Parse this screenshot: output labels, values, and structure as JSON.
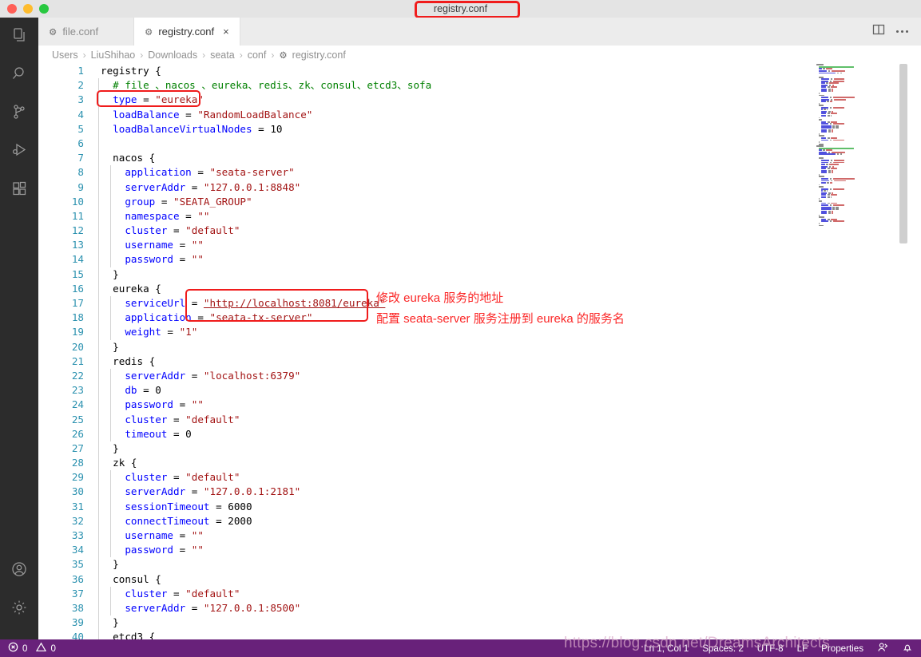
{
  "titlebar": {
    "title": "registry.conf",
    "traffic_lights": [
      "close-red",
      "minimize-yellow",
      "maximize-green"
    ],
    "annotation_color": "#f01c1c"
  },
  "activitybar": {
    "items": [
      {
        "name": "explorer",
        "icon": "files-icon"
      },
      {
        "name": "search",
        "icon": "search-icon"
      },
      {
        "name": "source-control",
        "icon": "source-control-icon"
      },
      {
        "name": "run-and-debug",
        "icon": "run-debug-icon"
      },
      {
        "name": "extensions",
        "icon": "extensions-icon"
      }
    ],
    "bottom_items": [
      {
        "name": "accounts",
        "icon": "account-icon"
      },
      {
        "name": "manage-settings",
        "icon": "gear-icon"
      }
    ]
  },
  "tabs": [
    {
      "label": "file.conf",
      "icon": "gear-icon",
      "active": false,
      "closable": false
    },
    {
      "label": "registry.conf",
      "icon": "gear-icon",
      "active": true,
      "closable": true,
      "close_label": "×"
    }
  ],
  "tab_actions": [
    {
      "name": "split-editor",
      "icon": "split-editor-icon"
    },
    {
      "name": "more-actions",
      "icon": "ellipsis-icon"
    }
  ],
  "breadcrumb": {
    "separator": "›",
    "items": [
      "Users",
      "LiuShihao",
      "Downloads",
      "seata",
      "conf"
    ],
    "file": "registry.conf",
    "file_icon": "gear-icon"
  },
  "editor": {
    "language": "conf",
    "lines": [
      {
        "n": 1,
        "indent": 0,
        "tokens": [
          {
            "t": "registry {",
            "c": "plain"
          }
        ]
      },
      {
        "n": 2,
        "indent": 1,
        "tokens": [
          {
            "t": "# file 、nacos 、eureka、redis、zk、consul、etcd3、sofa",
            "c": "cmt"
          }
        ]
      },
      {
        "n": 3,
        "indent": 1,
        "tokens": [
          {
            "t": "type",
            "c": "kw"
          },
          {
            "t": " = ",
            "c": "plain"
          },
          {
            "t": "\"eureka\"",
            "c": "str"
          }
        ]
      },
      {
        "n": 4,
        "indent": 1,
        "tokens": [
          {
            "t": "loadBalance",
            "c": "kw"
          },
          {
            "t": " = ",
            "c": "plain"
          },
          {
            "t": "\"RandomLoadBalance\"",
            "c": "str"
          }
        ]
      },
      {
        "n": 5,
        "indent": 1,
        "tokens": [
          {
            "t": "loadBalanceVirtualNodes",
            "c": "kw"
          },
          {
            "t": " = ",
            "c": "plain"
          },
          {
            "t": "10",
            "c": "num"
          }
        ]
      },
      {
        "n": 6,
        "indent": 1,
        "tokens": []
      },
      {
        "n": 7,
        "indent": 1,
        "tokens": [
          {
            "t": "nacos {",
            "c": "plain"
          }
        ]
      },
      {
        "n": 8,
        "indent": 2,
        "tokens": [
          {
            "t": "application",
            "c": "kw"
          },
          {
            "t": " = ",
            "c": "plain"
          },
          {
            "t": "\"seata-server\"",
            "c": "str"
          }
        ]
      },
      {
        "n": 9,
        "indent": 2,
        "tokens": [
          {
            "t": "serverAddr",
            "c": "kw"
          },
          {
            "t": " = ",
            "c": "plain"
          },
          {
            "t": "\"127.0.0.1:8848\"",
            "c": "str"
          }
        ]
      },
      {
        "n": 10,
        "indent": 2,
        "tokens": [
          {
            "t": "group",
            "c": "kw"
          },
          {
            "t": " = ",
            "c": "plain"
          },
          {
            "t": "\"SEATA_GROUP\"",
            "c": "str"
          }
        ]
      },
      {
        "n": 11,
        "indent": 2,
        "tokens": [
          {
            "t": "namespace",
            "c": "kw"
          },
          {
            "t": " = ",
            "c": "plain"
          },
          {
            "t": "\"\"",
            "c": "str"
          }
        ]
      },
      {
        "n": 12,
        "indent": 2,
        "tokens": [
          {
            "t": "cluster",
            "c": "kw"
          },
          {
            "t": " = ",
            "c": "plain"
          },
          {
            "t": "\"default\"",
            "c": "str"
          }
        ]
      },
      {
        "n": 13,
        "indent": 2,
        "tokens": [
          {
            "t": "username",
            "c": "kw"
          },
          {
            "t": " = ",
            "c": "plain"
          },
          {
            "t": "\"\"",
            "c": "str"
          }
        ]
      },
      {
        "n": 14,
        "indent": 2,
        "tokens": [
          {
            "t": "password",
            "c": "kw"
          },
          {
            "t": " = ",
            "c": "plain"
          },
          {
            "t": "\"\"",
            "c": "str"
          }
        ]
      },
      {
        "n": 15,
        "indent": 1,
        "tokens": [
          {
            "t": "}",
            "c": "plain"
          }
        ]
      },
      {
        "n": 16,
        "indent": 1,
        "tokens": [
          {
            "t": "eureka {",
            "c": "plain"
          }
        ]
      },
      {
        "n": 17,
        "indent": 2,
        "tokens": [
          {
            "t": "serviceUrl",
            "c": "kw"
          },
          {
            "t": " = ",
            "c": "plain"
          },
          {
            "t": "\"http://localhost:8081/eureka\"",
            "c": "str link"
          }
        ]
      },
      {
        "n": 18,
        "indent": 2,
        "tokens": [
          {
            "t": "application",
            "c": "kw"
          },
          {
            "t": " = ",
            "c": "plain"
          },
          {
            "t": "\"seata-tx-server\"",
            "c": "str"
          }
        ]
      },
      {
        "n": 19,
        "indent": 2,
        "tokens": [
          {
            "t": "weight",
            "c": "kw"
          },
          {
            "t": " = ",
            "c": "plain"
          },
          {
            "t": "\"1\"",
            "c": "str"
          }
        ]
      },
      {
        "n": 20,
        "indent": 1,
        "tokens": [
          {
            "t": "}",
            "c": "plain"
          }
        ]
      },
      {
        "n": 21,
        "indent": 1,
        "tokens": [
          {
            "t": "redis {",
            "c": "plain"
          }
        ]
      },
      {
        "n": 22,
        "indent": 2,
        "tokens": [
          {
            "t": "serverAddr",
            "c": "kw"
          },
          {
            "t": " = ",
            "c": "plain"
          },
          {
            "t": "\"localhost:6379\"",
            "c": "str"
          }
        ]
      },
      {
        "n": 23,
        "indent": 2,
        "tokens": [
          {
            "t": "db",
            "c": "kw"
          },
          {
            "t": " = ",
            "c": "plain"
          },
          {
            "t": "0",
            "c": "num"
          }
        ]
      },
      {
        "n": 24,
        "indent": 2,
        "tokens": [
          {
            "t": "password",
            "c": "kw"
          },
          {
            "t": " = ",
            "c": "plain"
          },
          {
            "t": "\"\"",
            "c": "str"
          }
        ]
      },
      {
        "n": 25,
        "indent": 2,
        "tokens": [
          {
            "t": "cluster",
            "c": "kw"
          },
          {
            "t": " = ",
            "c": "plain"
          },
          {
            "t": "\"default\"",
            "c": "str"
          }
        ]
      },
      {
        "n": 26,
        "indent": 2,
        "tokens": [
          {
            "t": "timeout",
            "c": "kw"
          },
          {
            "t": " = ",
            "c": "plain"
          },
          {
            "t": "0",
            "c": "num"
          }
        ]
      },
      {
        "n": 27,
        "indent": 1,
        "tokens": [
          {
            "t": "}",
            "c": "plain"
          }
        ]
      },
      {
        "n": 28,
        "indent": 1,
        "tokens": [
          {
            "t": "zk {",
            "c": "plain"
          }
        ]
      },
      {
        "n": 29,
        "indent": 2,
        "tokens": [
          {
            "t": "cluster",
            "c": "kw"
          },
          {
            "t": " = ",
            "c": "plain"
          },
          {
            "t": "\"default\"",
            "c": "str"
          }
        ]
      },
      {
        "n": 30,
        "indent": 2,
        "tokens": [
          {
            "t": "serverAddr",
            "c": "kw"
          },
          {
            "t": " = ",
            "c": "plain"
          },
          {
            "t": "\"127.0.0.1:2181\"",
            "c": "str"
          }
        ]
      },
      {
        "n": 31,
        "indent": 2,
        "tokens": [
          {
            "t": "sessionTimeout",
            "c": "kw"
          },
          {
            "t": " = ",
            "c": "plain"
          },
          {
            "t": "6000",
            "c": "num"
          }
        ]
      },
      {
        "n": 32,
        "indent": 2,
        "tokens": [
          {
            "t": "connectTimeout",
            "c": "kw"
          },
          {
            "t": " = ",
            "c": "plain"
          },
          {
            "t": "2000",
            "c": "num"
          }
        ]
      },
      {
        "n": 33,
        "indent": 2,
        "tokens": [
          {
            "t": "username",
            "c": "kw"
          },
          {
            "t": " = ",
            "c": "plain"
          },
          {
            "t": "\"\"",
            "c": "str"
          }
        ]
      },
      {
        "n": 34,
        "indent": 2,
        "tokens": [
          {
            "t": "password",
            "c": "kw"
          },
          {
            "t": " = ",
            "c": "plain"
          },
          {
            "t": "\"\"",
            "c": "str"
          }
        ]
      },
      {
        "n": 35,
        "indent": 1,
        "tokens": [
          {
            "t": "}",
            "c": "plain"
          }
        ]
      },
      {
        "n": 36,
        "indent": 1,
        "tokens": [
          {
            "t": "consul {",
            "c": "plain"
          }
        ]
      },
      {
        "n": 37,
        "indent": 2,
        "tokens": [
          {
            "t": "cluster",
            "c": "kw"
          },
          {
            "t": " = ",
            "c": "plain"
          },
          {
            "t": "\"default\"",
            "c": "str"
          }
        ]
      },
      {
        "n": 38,
        "indent": 2,
        "tokens": [
          {
            "t": "serverAddr",
            "c": "kw"
          },
          {
            "t": " = ",
            "c": "plain"
          },
          {
            "t": "\"127.0.0.1:8500\"",
            "c": "str"
          }
        ]
      },
      {
        "n": 39,
        "indent": 1,
        "tokens": [
          {
            "t": "}",
            "c": "plain"
          }
        ]
      },
      {
        "n": 40,
        "indent": 1,
        "tokens": [
          {
            "t": "etcd3 {",
            "c": "plain"
          }
        ]
      }
    ]
  },
  "annotations": {
    "color": "#fb2626",
    "note1": "修改 eureka 服务的地址",
    "note2": "配置 seata-server 服务注册到 eureka 的服务名"
  },
  "statusbar": {
    "background": "#68217a",
    "errors_icon": "error-circle-icon",
    "errors": "0",
    "warnings_icon": "warning-triangle-icon",
    "warnings": "0",
    "right_items": [
      {
        "name": "cursor-position",
        "label": "Ln 1, Col 1"
      },
      {
        "name": "indentation",
        "label": "Spaces: 2"
      },
      {
        "name": "encoding",
        "label": "UTF-8"
      },
      {
        "name": "eol",
        "label": "LF"
      },
      {
        "name": "language-mode",
        "label": "Properties"
      }
    ],
    "right_icons": [
      {
        "name": "live-share-icon"
      },
      {
        "name": "notifications-bell-icon"
      }
    ]
  },
  "watermark": "https://blog.csdn.net/DreamsArchitects"
}
